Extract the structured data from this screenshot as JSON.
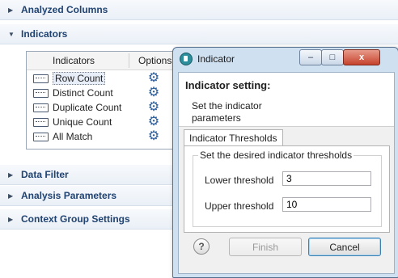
{
  "sections": {
    "analyzed_columns": "Analyzed Columns",
    "indicators": "Indicators",
    "data_filter": "Data Filter",
    "analysis_parameters": "Analysis Parameters",
    "context_group_settings": "Context Group Settings"
  },
  "indicators_table": {
    "headers": [
      "Indicators",
      "Options"
    ],
    "rows": [
      {
        "label": "Row Count",
        "selected": true
      },
      {
        "label": "Distinct Count"
      },
      {
        "label": "Duplicate Count"
      },
      {
        "label": "Unique Count"
      },
      {
        "label": "All Match"
      }
    ]
  },
  "dialog": {
    "window_title": "Indicator",
    "header_title": "Indicator setting:",
    "header_description": "Set the indicator parameters",
    "tab_label": "Indicator Thresholds",
    "group_title": "Set the desired indicator thresholds",
    "lower_label": "Lower threshold",
    "lower_value": "3",
    "upper_label": "Upper threshold",
    "upper_value": "10",
    "help_glyph": "?",
    "finish_label": "Finish",
    "cancel_label": "Cancel",
    "minimize_glyph": "–",
    "maximize_glyph": "□",
    "close_glyph": "x"
  },
  "colors": {
    "section_title": "#204372",
    "gear": "#2b5d9c",
    "dialog_frame": "#cfe0f1"
  }
}
